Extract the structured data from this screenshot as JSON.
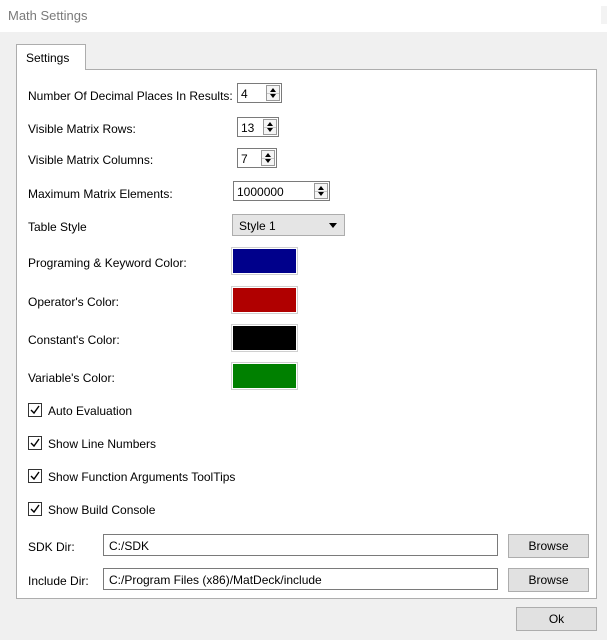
{
  "window": {
    "title": "Math Settings"
  },
  "tabs": [
    {
      "label": "Settings"
    }
  ],
  "settings": {
    "decimal_places": {
      "label": "Number Of Decimal Places In Results:",
      "value": "4"
    },
    "matrix_rows": {
      "label": "Visible Matrix Rows:",
      "value": "13"
    },
    "matrix_columns": {
      "label": "Visible Matrix Columns:",
      "value": "7"
    },
    "max_elements": {
      "label": "Maximum Matrix Elements:",
      "value": "1000000"
    },
    "table_style": {
      "label": "Table Style",
      "value": "Style 1"
    },
    "colors": [
      {
        "label": "Programing & Keyword Color:",
        "color": "#00008b"
      },
      {
        "label": "Operator's Color:",
        "color": "#b00000"
      },
      {
        "label": "Constant's Color:",
        "color": "#000000"
      },
      {
        "label": "Variable's Color:",
        "color": "#008000"
      }
    ],
    "checkboxes": [
      {
        "label": "Auto Evaluation",
        "checked": true
      },
      {
        "label": "Show Line Numbers",
        "checked": true
      },
      {
        "label": "Show Function Arguments ToolTips",
        "checked": true
      },
      {
        "label": "Show Build Console",
        "checked": true
      }
    ],
    "sdk_dir": {
      "label": "SDK Dir:",
      "value": "C:/SDK",
      "button": "Browse"
    },
    "include_dir": {
      "label": "Include Dir:",
      "value": "C:/Program Files (x86)/MatDeck/include",
      "button": "Browse"
    }
  },
  "footer": {
    "ok_label": "Ok"
  }
}
